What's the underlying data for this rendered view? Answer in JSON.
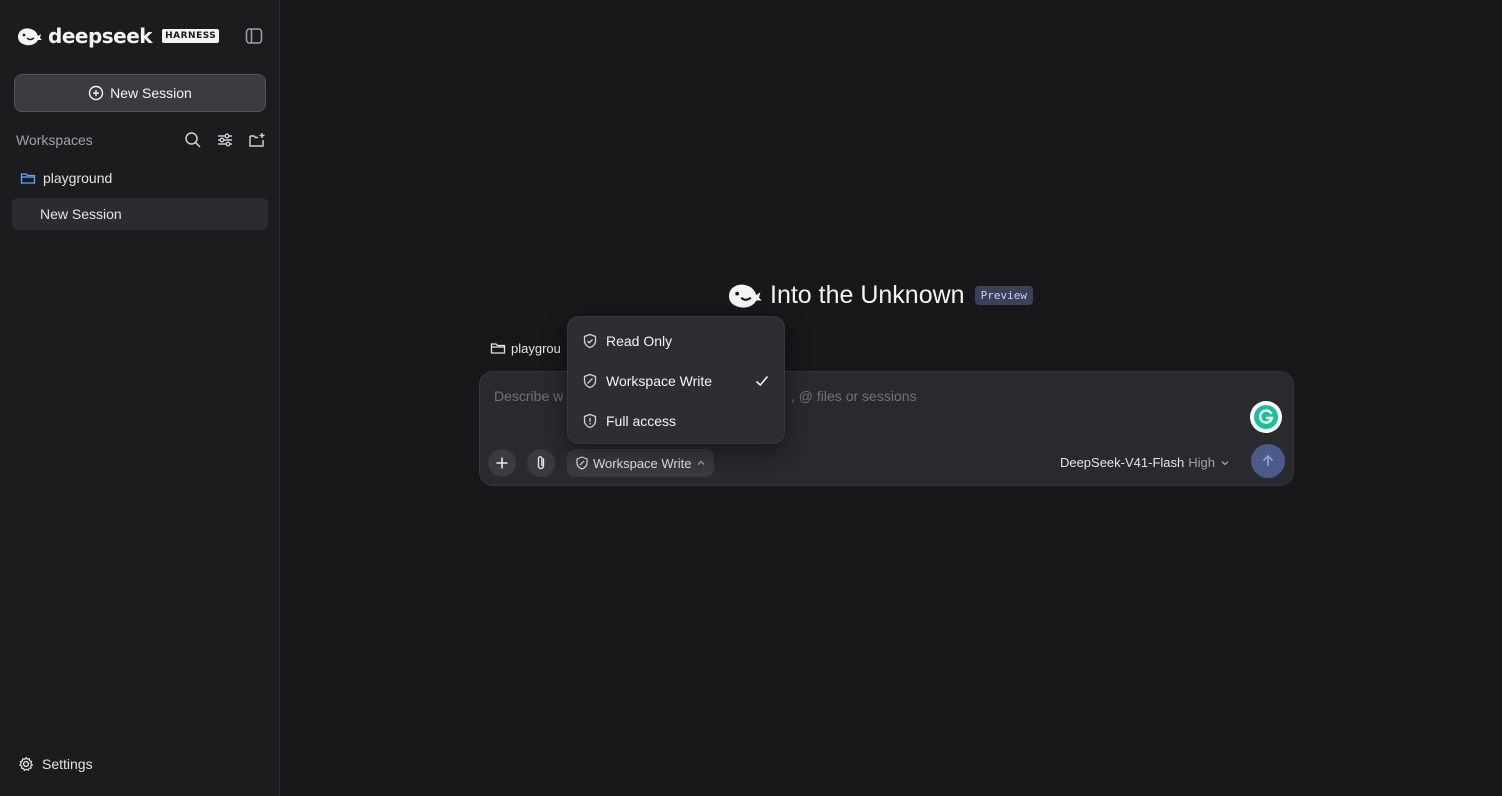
{
  "sidebar": {
    "brand_name": "deepseek",
    "brand_tag": "HARNESS",
    "new_session_label": "New Session",
    "workspaces_title": "Workspaces",
    "workspace": {
      "name": "playground",
      "sessions": [
        "New Session"
      ]
    },
    "settings_label": "Settings"
  },
  "main": {
    "hero_title": "Into the Unknown",
    "hero_badge": "Preview",
    "path_chip": "playgrou",
    "composer": {
      "placeholder_left": "Describe w",
      "placeholder_right": ", @ files or sessions",
      "permission_label": "Workspace Write",
      "model_name": "DeepSeek-V41-Flash",
      "model_level": "High"
    },
    "permission_menu": {
      "items": [
        {
          "label": "Read Only",
          "icon": "shield-check-icon",
          "selected": false
        },
        {
          "label": "Workspace Write",
          "icon": "shield-edit-icon",
          "selected": true
        },
        {
          "label": "Full access",
          "icon": "shield-alert-icon",
          "selected": false
        }
      ]
    }
  },
  "colors": {
    "background": "#18181b",
    "sidebar": "#1c1c1f",
    "accent_send": "#4a5a8a",
    "folder_icon": "#60a5fa"
  }
}
